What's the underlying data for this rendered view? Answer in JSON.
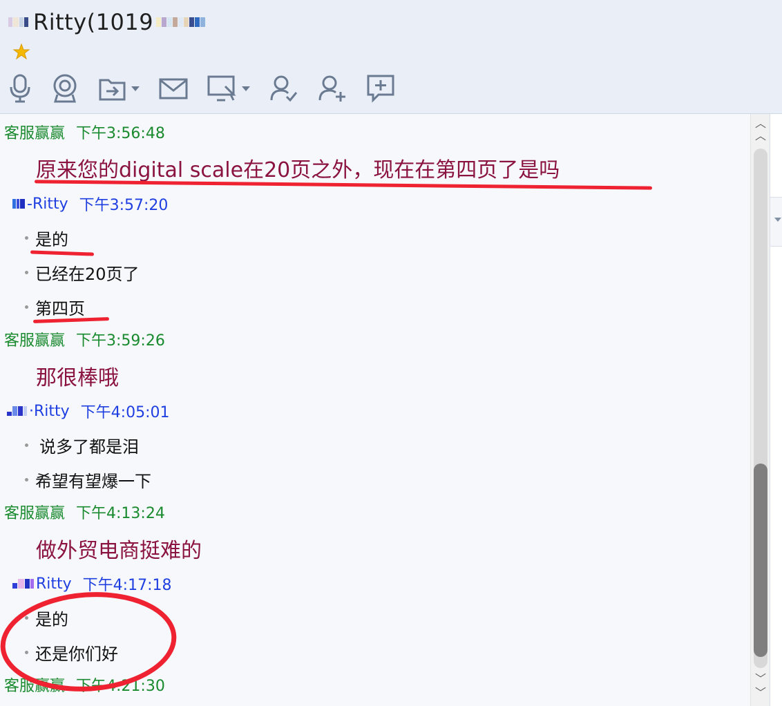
{
  "header": {
    "title": "Ritty(1019",
    "colors": {
      "background": "#e9eef7",
      "star": "#f5b800"
    },
    "toolbar": [
      {
        "icon": "microphone-icon"
      },
      {
        "icon": "camera-icon"
      },
      {
        "icon": "file-transfer-icon",
        "has_dropdown": true
      },
      {
        "icon": "mail-icon"
      },
      {
        "icon": "screen-share-icon",
        "has_dropdown": true
      },
      {
        "icon": "user-check-icon"
      },
      {
        "icon": "add-contact-icon"
      },
      {
        "icon": "add-comment-icon"
      }
    ]
  },
  "chat": {
    "messages": [
      {
        "sender": "客服赢赢",
        "time": "下午3:56:48",
        "lines": [
          "原来您的digital scale在20页之外，现在在第四页了是吗"
        ]
      },
      {
        "sender": "-Ritty",
        "time": "下午3:57:20",
        "lines": [
          "是的",
          "已经在20页了",
          "第四页"
        ]
      },
      {
        "sender": "客服赢赢",
        "time": "下午3:59:26",
        "lines": [
          "那很棒哦"
        ]
      },
      {
        "sender": "·Ritty",
        "time": "下午4:05:01",
        "lines": [
          "说多了都是泪",
          "希望有望爆一下"
        ]
      },
      {
        "sender": "客服赢赢",
        "time": "下午4:13:24",
        "lines": [
          "做外贸电商挺难的"
        ]
      },
      {
        "sender": "Ritty",
        "time": "下午4:17:18",
        "lines": [
          "是的",
          "还是你们好"
        ]
      },
      {
        "sender": "客服赢赢",
        "time": "下午4:21:30",
        "lines": []
      }
    ],
    "colors": {
      "agent": "#1a8a2e",
      "user": "#1f3fe0",
      "agent_text": "#8b1340",
      "annotation": "#ee2230"
    }
  }
}
